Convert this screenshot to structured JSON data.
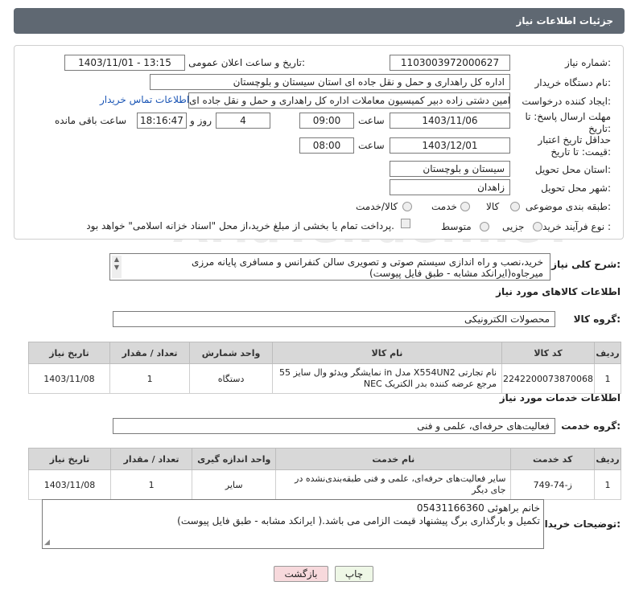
{
  "header": {
    "title": "جزئیات اطلاعات نیاز"
  },
  "form": {
    "need_number_label": "شماره نیاز:",
    "need_number": "1103003972000627",
    "announce_label": "تاریخ و ساعت اعلان عمومی:",
    "announce_value": "1403/11/01 - 13:15",
    "buyer_label": "نام دستگاه خریدار:",
    "buyer_value": "اداره کل راهداری و حمل و نقل جاده ای استان سیستان و بلوچستان",
    "creator_label": "ایجاد کننده درخواست:",
    "creator_value": "امین دشتی زاده دبیر کمیسیون معاملات اداره کل راهداری و حمل و نقل جاده ای",
    "contact_link": "اطلاعات تماس خریدار",
    "deadline_label": "مهلت ارسال پاسخ: تا تاریخ:",
    "deadline_date": "1403/11/06",
    "time_label": "ساعت",
    "deadline_time": "09:00",
    "days_value": "4",
    "days_label": "روز و",
    "remaining_time": "18:16:47",
    "remaining_label": "ساعت باقی مانده",
    "validity_label": "حداقل تاریخ اعتبار قیمت: تا تاریخ:",
    "validity_date": "1403/12/01",
    "validity_time": "08:00",
    "province_label": "استان محل تحویل:",
    "province_value": "سیستان و بلوچستان",
    "city_label": "شهر محل تحویل:",
    "city_value": "زاهدان",
    "category_label": "طبقه بندی موضوعی:",
    "category_options": [
      "کالا",
      "خدمت",
      "کالا/خدمت"
    ],
    "process_label": "نوع فرآیند خرید :",
    "process_options": [
      "جزیی",
      "متوسط"
    ],
    "payment_note": "پرداخت تمام یا بخشی از مبلغ خرید،از محل \"اسناد خزانه اسلامی\" خواهد بود."
  },
  "description": {
    "label": "شرح کلی نیاز:",
    "value": "خرید،نصب و راه اندازی سیستم صوتی و تصویری سالن کنفرانس و مسافری پایانه مرزی میرجاوه(ایرانکد مشابه - طبق فایل پیوست)"
  },
  "goods": {
    "section_title": "اطلاعات کالاهای مورد نیاز",
    "group_label": "گروه کالا:",
    "group_value": "محصولات الکترونیکی",
    "columns": [
      "ردیف",
      "کد کالا",
      "نام کالا",
      "واحد شمارش",
      "تعداد / مقدار",
      "تاریخ نیاز"
    ],
    "rows": [
      {
        "row": "1",
        "code": "2242200073870068",
        "name": "نمایشگر ویدئو وال سایز 55 in مدل X554UN2 نام تجارتی NEC مرجع عرضه کننده بدر الکتریک",
        "unit": "دستگاه",
        "qty": "1",
        "date": "1403/11/08"
      }
    ]
  },
  "services": {
    "section_title": "اطلاعات خدمات مورد نیاز",
    "group_label": "گروه خدمت:",
    "group_value": "فعالیت‌های حرفه‌ای، علمی و فنی",
    "columns": [
      "ردیف",
      "کد خدمت",
      "نام خدمت",
      "واحد اندازه گیری",
      "تعداد / مقدار",
      "تاریخ نیاز"
    ],
    "rows": [
      {
        "row": "1",
        "code": "ز-74-749",
        "name": "سایر فعالیت‌های حرفه‌ای، علمی و فنی طبقه‌بندی‌نشده در جای دیگر",
        "unit": "سایر",
        "qty": "1",
        "date": "1403/11/08"
      }
    ]
  },
  "buyer_notes": {
    "label": "توضیحات خریدار:",
    "line1": "05431166360 خانم براهوئی",
    "line2": "تکمیل و بارگذاری برگ پیشنهاد قیمت الزامی می باشد.( ایرانکد مشابه - طبق فایل پیوست)"
  },
  "buttons": {
    "print": "چاپ",
    "back": "بازگشت"
  },
  "watermark": "AriaTender.neT",
  "colors": {
    "header_bg": "#5f6872",
    "link": "#1a55b5",
    "back_btn_bg": "#f7d9dc",
    "print_btn_bg": "#eef7e6"
  }
}
